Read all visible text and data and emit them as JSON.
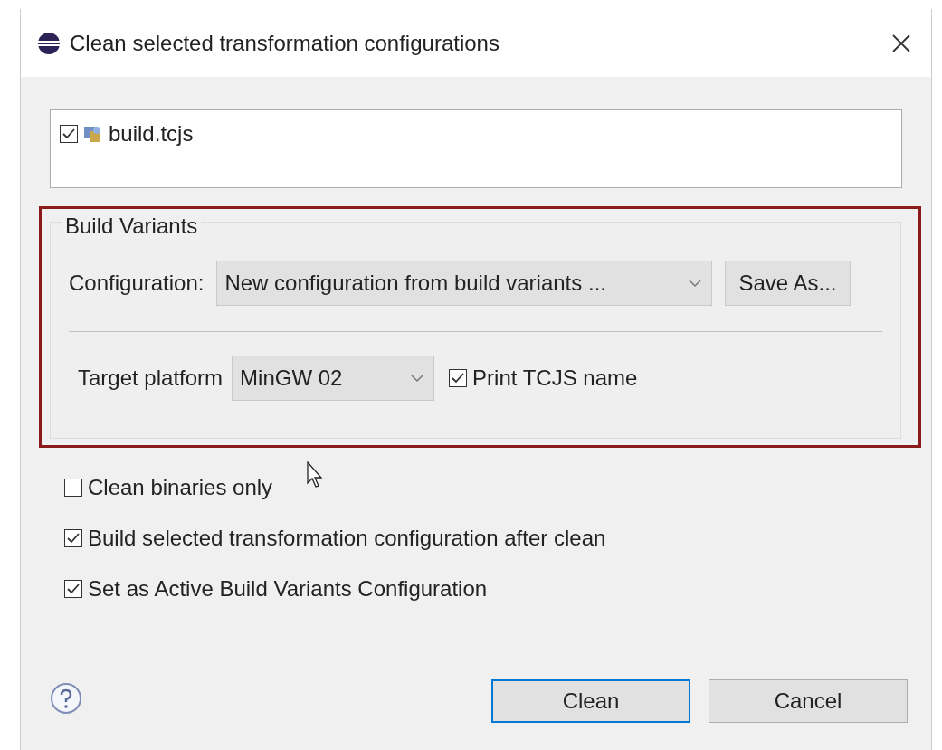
{
  "window": {
    "title": "Clean selected transformation configurations"
  },
  "files": [
    {
      "label": "build.tcjs",
      "checked": true
    }
  ],
  "build_variants": {
    "title": "Build Variants",
    "configuration_label": "Configuration:",
    "configuration_value": "New configuration from build variants ...",
    "save_as_button": "Save As...",
    "target_platform_label": "Target platform",
    "target_platform_value": "MinGW 02",
    "print_name": {
      "label": "Print TCJS name",
      "checked": true
    }
  },
  "options": [
    {
      "label": "Clean binaries only",
      "checked": false
    },
    {
      "label": "Build selected transformation configuration after clean",
      "checked": true
    },
    {
      "label": "Set as Active Build Variants Configuration",
      "checked": true
    }
  ],
  "buttons": [
    {
      "label": "Clean",
      "default": true
    },
    {
      "label": "Cancel",
      "default": false
    }
  ]
}
